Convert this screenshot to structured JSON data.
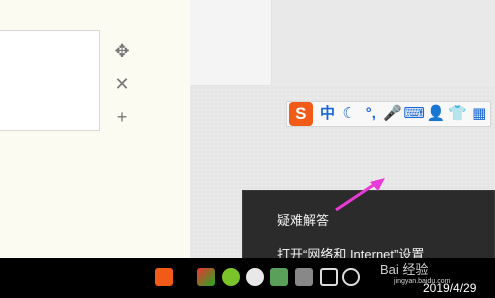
{
  "side_icons": [
    "move-icon",
    "close-icon",
    "add-icon"
  ],
  "ime": {
    "logo": "S",
    "items": [
      "中",
      "☾",
      "°,",
      "🎤",
      "⌨",
      "👤",
      "👕",
      "▦"
    ]
  },
  "menu": {
    "item1": "疑难解答",
    "item2": "打开“网络和 Internet”设置"
  },
  "taskbar": {
    "date": "2019/4/29",
    "watermark": "Bai 经验",
    "watermark_url": "jingyan.baidu.com"
  },
  "colors": {
    "arrow": "#e83ad6",
    "ime_accent": "#1b67d6",
    "sogou": "#f25a18"
  }
}
